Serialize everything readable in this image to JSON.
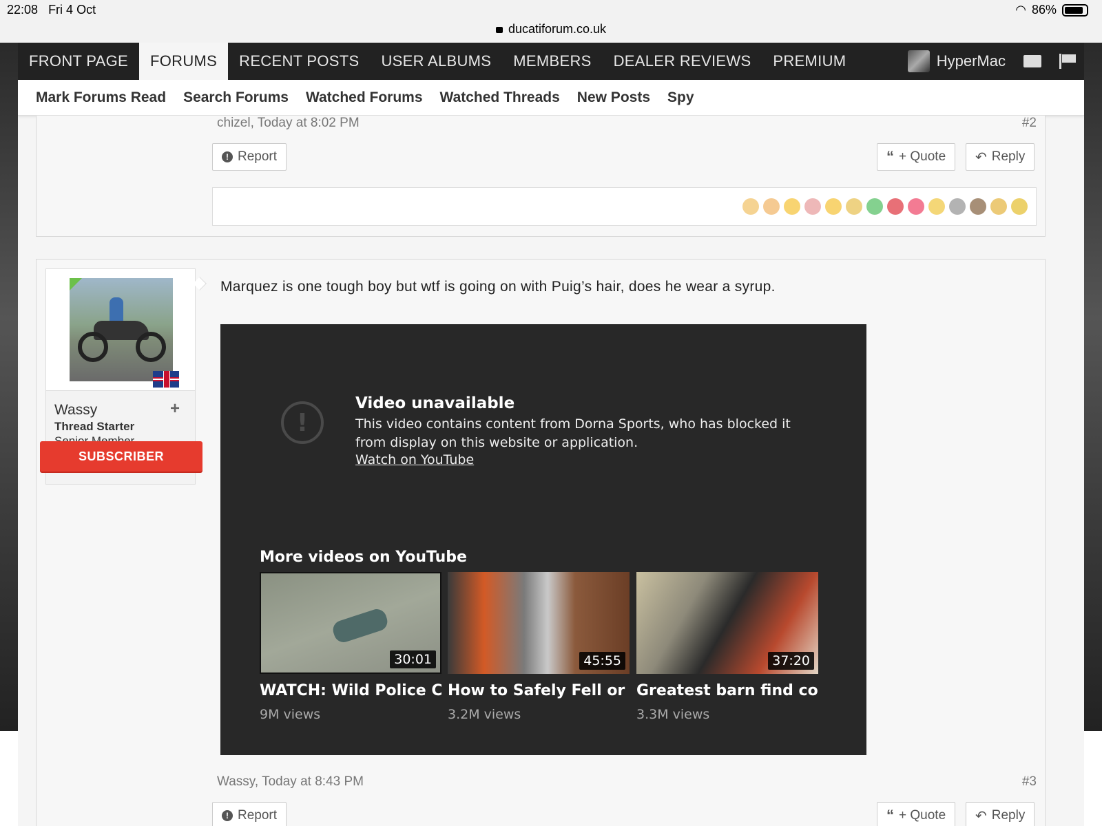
{
  "status": {
    "time": "22:08",
    "date": "Fri 4 Oct",
    "battery": "86%",
    "url": "ducatiforum.co.uk"
  },
  "nav": {
    "tabs": [
      "FRONT PAGE",
      "FORUMS",
      "RECENT POSTS",
      "USER ALBUMS",
      "MEMBERS",
      "DEALER REVIEWS",
      "PREMIUM"
    ],
    "active": "FORUMS",
    "username": "HyperMac"
  },
  "subnav": [
    "Mark Forums Read",
    "Search Forums",
    "Watched Forums",
    "Watched Threads",
    "New Posts",
    "Spy"
  ],
  "post2": {
    "meta": "chizel, Today at 8:02 PM",
    "number": "#2",
    "report": "Report",
    "quote": "+ Quote",
    "reply": "Reply"
  },
  "reactions": [
    "thumbs-up",
    "thumbs-down",
    "tongue",
    "facepalm",
    "laugh",
    "crown",
    "check",
    "cross",
    "heart",
    "medal",
    "tools",
    "poo",
    "lock",
    "radioactive"
  ],
  "reaction_colors": [
    "#f2c46d",
    "#f2b86d",
    "#f5c542",
    "#e8a0a0",
    "#f5c542",
    "#e8c35a",
    "#5bc26a",
    "#e0404a",
    "#ef4f6f",
    "#f0c94a",
    "#9a9a9a",
    "#8a6a4a",
    "#e6b84a",
    "#e6c23a"
  ],
  "post3": {
    "user": {
      "name": "Wassy",
      "title": "Thread Starter",
      "rank": "Senior Member",
      "badge": "SUBSCRIBER"
    },
    "message": "Marquez is one tough boy but wtf is going on with Puig’s hair, does he wear a syrup.",
    "video": {
      "title": "Video unavailable",
      "message": "This video contains content from Dorna Sports, who has blocked it from display on this website or application.",
      "link": "Watch on YouTube",
      "more": "More videos on YouTube",
      "items": [
        {
          "title": "WATCH: Wild Police C...",
          "views": "9M views",
          "duration": "30:01"
        },
        {
          "title": "How to Safely Fell or ...",
          "views": "3.2M views",
          "duration": "45:55"
        },
        {
          "title": "Greatest barn find coll...",
          "views": "3.3M views",
          "duration": "37:20"
        }
      ]
    },
    "meta": "Wassy, Today at 8:43 PM",
    "number": "#3",
    "report": "Report",
    "quote": "+ Quote",
    "reply": "Reply"
  }
}
